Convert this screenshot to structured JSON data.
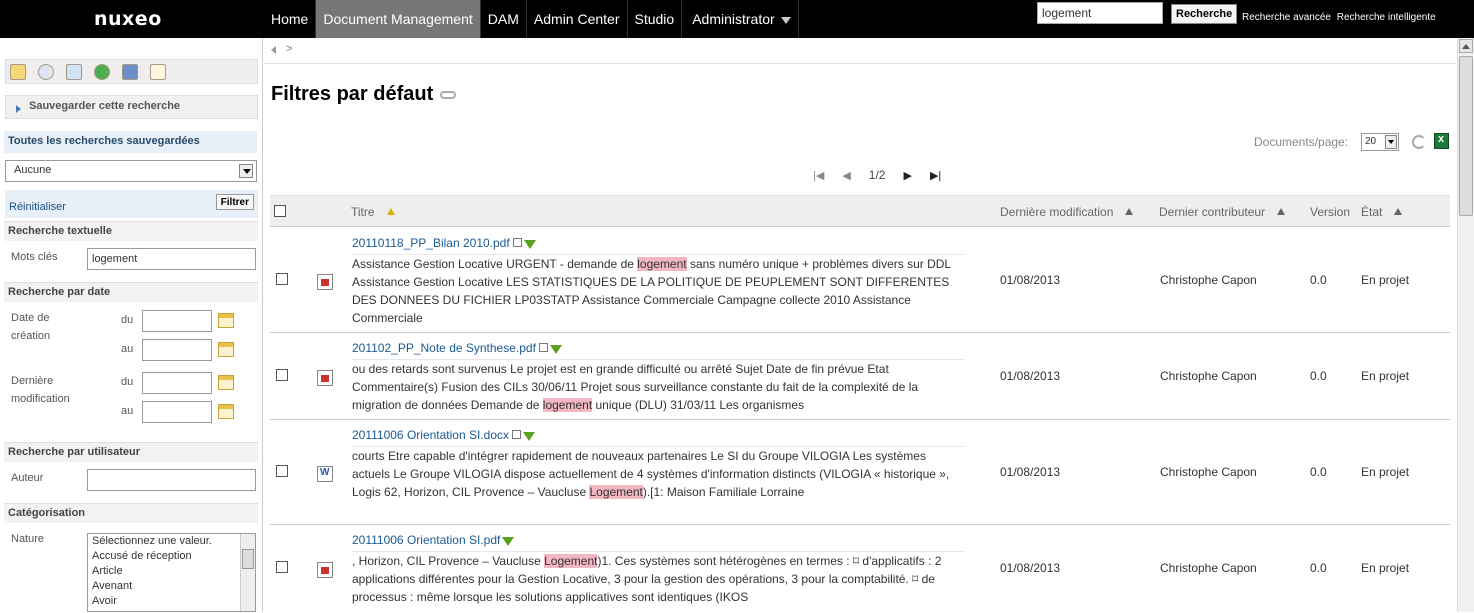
{
  "app": {
    "logo": "nuxeo"
  },
  "nav": {
    "items": [
      {
        "label": "Home",
        "active": false
      },
      {
        "label": "Document Management",
        "active": true
      },
      {
        "label": "DAM",
        "active": false
      },
      {
        "label": "Admin Center",
        "active": false
      },
      {
        "label": "Studio",
        "active": false
      },
      {
        "label": "Administrator",
        "active": false
      }
    ]
  },
  "top_search": {
    "value": "logement",
    "button": "Recherche",
    "links": [
      "Recherche avancée",
      "Recherche intelligente"
    ]
  },
  "left": {
    "tool_icons": [
      "folder-search-icon",
      "magnifier-icon",
      "tag-icon",
      "globe-icon",
      "notepad-icon",
      "edit-list-icon"
    ],
    "save_search": "Sauvegarder cette recherche",
    "saved_heading": "Toutes les recherches sauvegardées",
    "saved_select": "Aucune",
    "reset": "Réinitialiser",
    "filter": "Filtrer",
    "text_section": "Recherche textuelle",
    "keywords_label": "Mots clés",
    "keywords_value": "logement",
    "date_section": "Recherche par date",
    "creation_label_1": "Date de",
    "creation_label_2": "création",
    "modif_label_1": "Dernière",
    "modif_label_2": "modification",
    "from": "du",
    "to": "au",
    "user_section": "Recherche par utilisateur",
    "author_label": "Auteur",
    "cat_section": "Catégorisation",
    "nature_label": "Nature",
    "nature_options": [
      "Sélectionnez une valeur.",
      "Accusé de réception",
      "Article",
      "Avenant",
      "Avoir"
    ]
  },
  "main": {
    "title": "Filtres par défaut",
    "docs_per_page_label": "Documents/page:",
    "docs_per_page": "20",
    "pager": "1/2",
    "columns": {
      "title": "Titre",
      "modified": "Dernière modification",
      "contributor": "Dernier contributeur",
      "version": "Version",
      "state": "État"
    },
    "rows": [
      {
        "type": "pdf",
        "title": "20110118_PP_Bilan 2010.pdf",
        "excerpt_pre": "Assistance Gestion Locative URGENT - demande de ",
        "highlight": "logement",
        "excerpt_post": " sans numéro unique + problèmes divers sur DDL Assistance Gestion Locative LES STATISTIQUES DE LA POLITIQUE DE PEUPLEMENT SONT DIFFERENTES DES DONNEES DU FICHIER LP03STATP Assistance Commerciale Campagne collecte 2010 Assistance Commerciale",
        "modified": "01/08/2013",
        "contributor": "Christophe Capon",
        "version": "0.0",
        "state": "En projet"
      },
      {
        "type": "pdf",
        "title": "201102_PP_Note de Synthese.pdf",
        "excerpt_pre": "ou des retards sont survenus Le projet est en grande difficulté ou arrêté Sujet Date de fin prévue Etat Commentaire(s) Fusion des CILs 30/06/11 Projet sous surveillance constante du fait de la complexité de la migration de données Demande de ",
        "highlight": "logement",
        "excerpt_post": " unique (DLU) 31/03/11 Les organismes",
        "modified": "01/08/2013",
        "contributor": "Christophe Capon",
        "version": "0.0",
        "state": "En projet"
      },
      {
        "type": "doc",
        "title": "20111006 Orientation SI.docx",
        "excerpt_pre": "courts Etre capable d'intégrer rapidement de nouveaux partenaires Le SI du Groupe VILOGIA Les systèmes actuels Le Groupe VILOGIA dispose actuellement de 4 systèmes d'information distincts (VILOGIA « historique », Logis 62, Horizon, CIL Provence – Vaucluse ",
        "highlight": "Logement",
        "excerpt_post": ").[1: Maison Familiale Lorraine",
        "modified": "01/08/2013",
        "contributor": "Christophe Capon",
        "version": "0.0",
        "state": "En projet"
      },
      {
        "type": "pdf",
        "title": "20111006 Orientation SI.pdf",
        "excerpt_pre": ", Horizon, CIL Provence – Vaucluse ",
        "highlight": "Logement",
        "excerpt_post": ")1. Ces systèmes sont hétérogènes en termes : ⌑ d'applicatifs : 2 applications différentes pour la Gestion Locative, 3 pour la gestion des opérations, 3 pour la comptabilité. ⌑ de processus : même lorsque les solutions applicatives sont identiques (IKOS",
        "modified": "01/08/2013",
        "contributor": "Christophe Capon",
        "version": "0.0",
        "state": "En projet"
      }
    ]
  }
}
